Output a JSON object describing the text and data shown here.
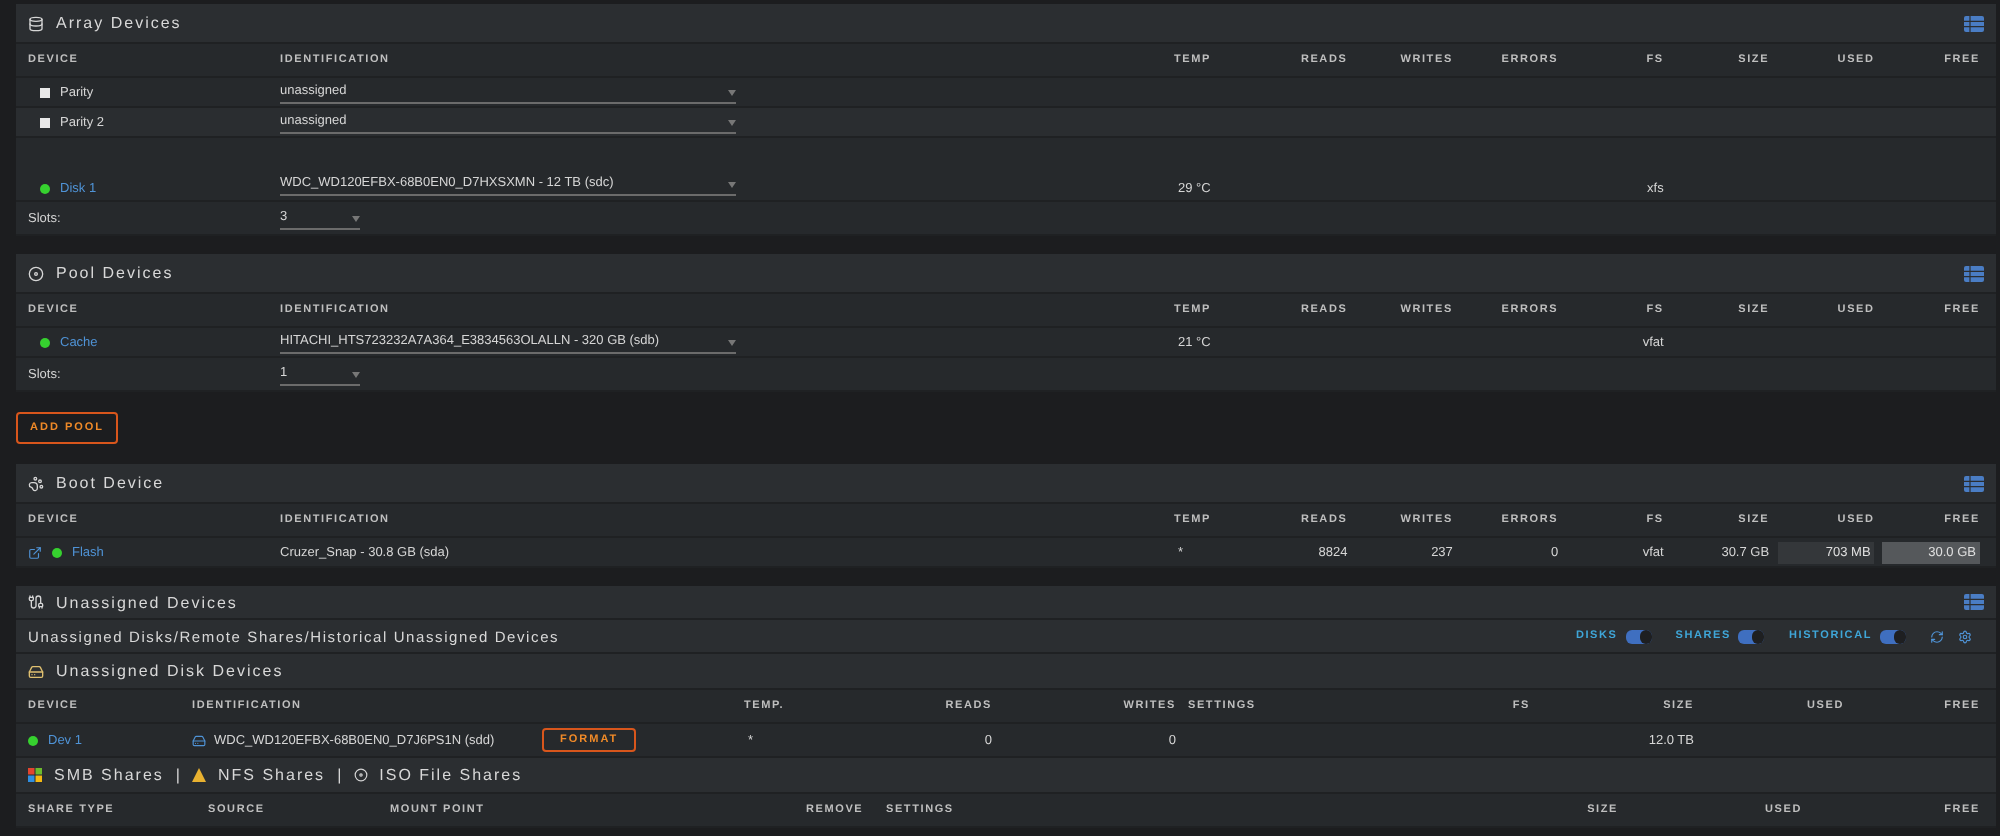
{
  "array_devices": {
    "title": "Array Devices",
    "columns": [
      "DEVICE",
      "IDENTIFICATION",
      "TEMP",
      "READS",
      "WRITES",
      "ERRORS",
      "FS",
      "SIZE",
      "USED",
      "FREE"
    ],
    "rows": [
      {
        "assigned": false,
        "device": "Parity",
        "identification": "unassigned"
      },
      {
        "assigned": false,
        "device": "Parity 2",
        "identification": "unassigned"
      },
      {
        "assigned": true,
        "device": "Disk 1",
        "identification": "WDC_WD120EFBX-68B0EN0_D7HXSXMN - 12 TB (sdc)",
        "temp": "29 °C",
        "fs": "xfs"
      }
    ],
    "slots": {
      "label": "Slots:",
      "value": "3"
    }
  },
  "pool_devices": {
    "title": "Pool Devices",
    "columns": [
      "DEVICE",
      "IDENTIFICATION",
      "TEMP",
      "READS",
      "WRITES",
      "ERRORS",
      "FS",
      "SIZE",
      "USED",
      "FREE"
    ],
    "rows": [
      {
        "assigned": true,
        "device": "Cache",
        "identification": "HITACHI_HTS723232A7A364_E3834563OLALLN - 320 GB (sdb)",
        "temp": "21 °C",
        "fs": "vfat"
      }
    ],
    "slots": {
      "label": "Slots:",
      "value": "1"
    }
  },
  "add_pool_button": "ADD POOL",
  "boot_device": {
    "title": "Boot Device",
    "columns": [
      "DEVICE",
      "IDENTIFICATION",
      "TEMP",
      "READS",
      "WRITES",
      "ERRORS",
      "FS",
      "SIZE",
      "USED",
      "FREE"
    ],
    "rows": [
      {
        "assigned": true,
        "device": "Flash",
        "identification": "Cruzer_Snap - 30.8 GB (sda)",
        "temp": "*",
        "reads": "8824",
        "writes": "237",
        "errors": "0",
        "fs": "vfat",
        "size": "30.7 GB",
        "used": "703 MB",
        "free": "30.0 GB"
      }
    ]
  },
  "unassigned_devices": {
    "title": "Unassigned Devices",
    "subtitle": "Unassigned Disks/Remote Shares/Historical Unassigned Devices",
    "toggles": [
      {
        "label": "DISKS",
        "on": true
      },
      {
        "label": "SHARES",
        "on": true
      },
      {
        "label": "HISTORICAL",
        "on": true
      }
    ],
    "disk_devices": {
      "title": "Unassigned Disk Devices",
      "columns": [
        "DEVICE",
        "IDENTIFICATION",
        "TEMP.",
        "READS",
        "WRITES",
        "SETTINGS",
        "FS",
        "SIZE",
        "USED",
        "FREE"
      ],
      "rows": [
        {
          "assigned": true,
          "device": "Dev 1",
          "identification": "WDC_WD120EFBX-68B0EN0_D7J6PS1N (sdd)",
          "button": "FORMAT",
          "temp": "*",
          "reads": "0",
          "writes": "0",
          "size": "12.0 TB"
        }
      ]
    },
    "shares": {
      "titles": [
        "SMB Shares",
        "NFS Shares",
        "ISO File Shares"
      ],
      "separator": "|",
      "columns": [
        "SHARE TYPE",
        "SOURCE",
        "MOUNT POINT",
        "REMOVE",
        "SETTINGS",
        "SIZE",
        "USED",
        "FREE"
      ]
    }
  }
}
